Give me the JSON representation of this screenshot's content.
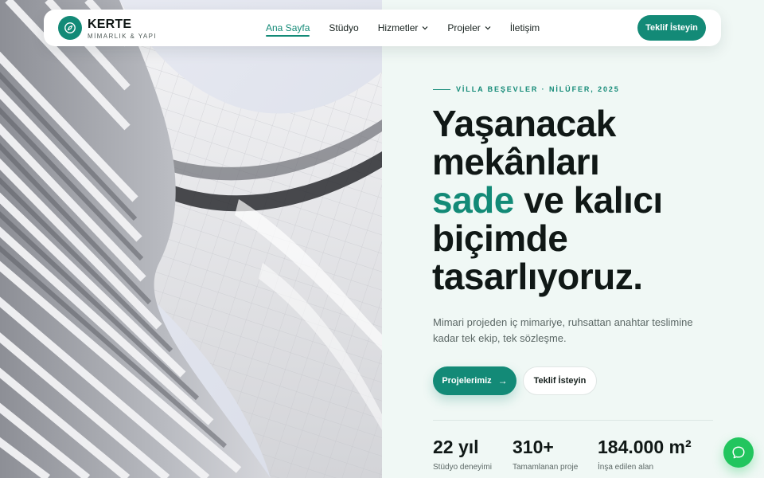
{
  "brand": {
    "name": "KERTE",
    "tagline": "MİMARLIK & YAPI",
    "logo_icon": "compass-icon",
    "accent_color": "#138a77"
  },
  "nav": {
    "items": [
      {
        "label": "Ana Sayfa",
        "active": true,
        "has_dropdown": false
      },
      {
        "label": "Stüdyo",
        "active": false,
        "has_dropdown": false
      },
      {
        "label": "Hizmetler",
        "active": false,
        "has_dropdown": true
      },
      {
        "label": "Projeler",
        "active": false,
        "has_dropdown": true
      },
      {
        "label": "İletişim",
        "active": false,
        "has_dropdown": false
      }
    ],
    "cta_label": "Teklif İsteyin"
  },
  "hero": {
    "image_alt": "architecture-photo",
    "eyebrow": "VİLLA BEŞEVLER · NİLÜFER, 2025",
    "headline": {
      "line1": "Yaşanacak",
      "line2": "mekânları",
      "accent_word": "sade",
      "line3_rest": " ve kalıcı",
      "line4": "biçimde",
      "line5": "tasarlıyoruz."
    },
    "lead": "Mimari projeden iç mimariye, ruhsattan anahtar teslimine kadar tek ekip, tek sözleşme.",
    "primary_button": "Projelerimiz",
    "primary_button_icon": "arrow-right-icon",
    "secondary_button": "Teklif İsteyin"
  },
  "stats": [
    {
      "value": "22 yıl",
      "label": "Stüdyo deneyimi"
    },
    {
      "value": "310+",
      "label": "Tamamlanan proje"
    },
    {
      "value": "184.000 m²",
      "label": "İnşa edilen alan"
    }
  ],
  "chat": {
    "icon": "chat-bubble-icon",
    "color": "#22c55e"
  }
}
